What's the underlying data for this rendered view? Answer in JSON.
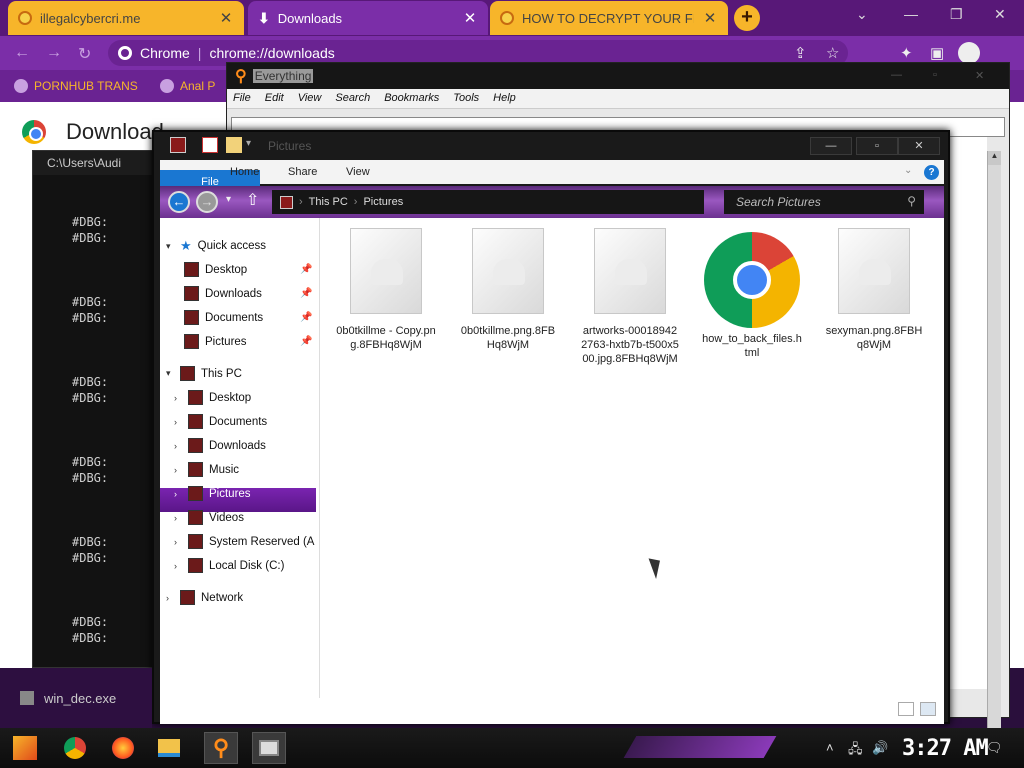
{
  "browser": {
    "tabs": [
      {
        "label": "illegalcybercri.me",
        "close": "✕"
      },
      {
        "label": "Downloads",
        "close": "✕"
      },
      {
        "label": "HOW TO DECRYPT YOUR FIL",
        "close": "✕"
      }
    ],
    "new_tab": "+",
    "omnibox": {
      "site": "Chrome",
      "separator": "|",
      "url": "chrome://downloads"
    },
    "bookmarks": [
      "PORNHUB TRANS",
      "Anal P"
    ],
    "page_title": "Download"
  },
  "console": {
    "title": "C:\\Users\\Audi",
    "lines": [
      "#DBG:",
      "#DBG:",
      "#DBG:",
      "#DBG:",
      "#DBG:",
      "#DBG:",
      "#DBG:",
      "#DBG:",
      "#DBG:",
      "#DBG:",
      "#DBG:",
      "#DBG:"
    ]
  },
  "everything": {
    "title": "Everything",
    "menu": [
      "File",
      "Edit",
      "View",
      "Search",
      "Bookmarks",
      "Tools",
      "Help"
    ]
  },
  "explorer": {
    "title": "Pictures",
    "ribbon_tabs": [
      "File",
      "Home",
      "Share",
      "View"
    ],
    "help": "?",
    "path": [
      "This PC",
      "Pictures"
    ],
    "search_placeholder": "Search Pictures",
    "nav": {
      "quick_access": "Quick access",
      "qa_items": [
        "Desktop",
        "Downloads",
        "Documents",
        "Pictures"
      ],
      "this_pc": "This PC",
      "pc_items": [
        "Desktop",
        "Documents",
        "Downloads",
        "Music",
        "Pictures",
        "Videos",
        "System Reserved (A",
        "Local Disk (C:)"
      ],
      "network": "Network"
    },
    "selected_nav": "Pictures",
    "files": [
      {
        "name": "0b0tkillme - Copy.png.8FBHq8WjM",
        "icon": "generic-file-icon"
      },
      {
        "name": "0b0tkillme.png.8FBHq8WjM",
        "icon": "generic-file-icon"
      },
      {
        "name": "artworks-000189422763-hxtb7b-t500x500.jpg.8FBHq8WjM",
        "icon": "generic-file-icon"
      },
      {
        "name": "how_to_back_files.html",
        "icon": "chrome-icon"
      },
      {
        "name": "sexyman.png.8FBHq8WjM",
        "icon": "generic-file-icon"
      }
    ]
  },
  "notification": {
    "label": "win_dec.exe"
  },
  "taskbar": {
    "clock": "3:27 AM"
  },
  "colors": {
    "accent_purple": "#7b2ea8",
    "tab_yellow": "#f7b52a",
    "file_tab_blue": "#1a77d2"
  }
}
